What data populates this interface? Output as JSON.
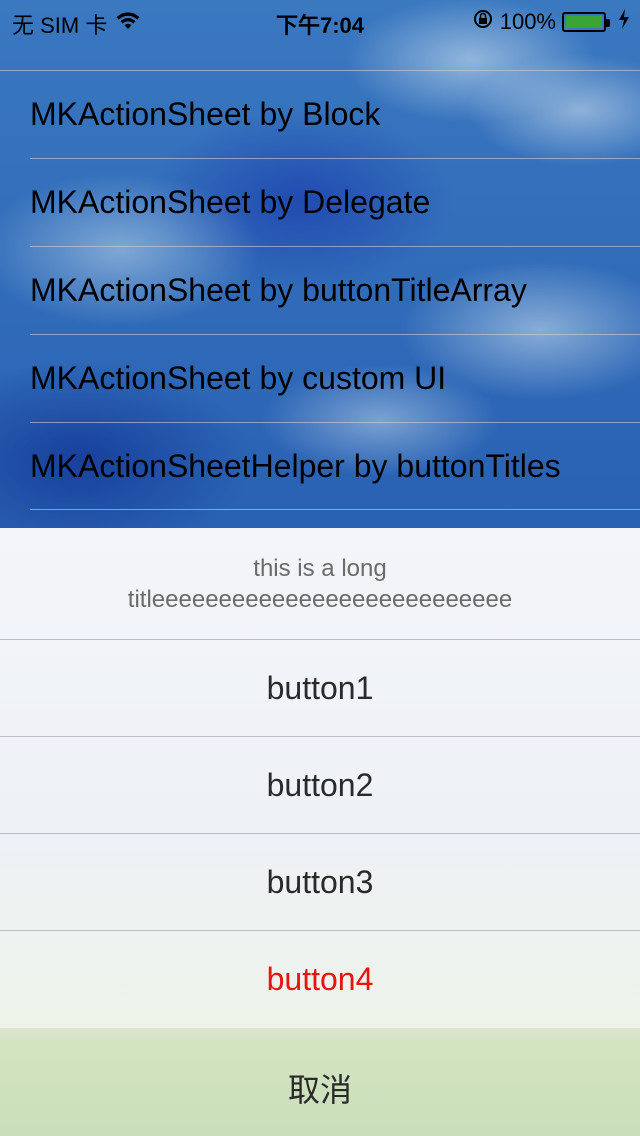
{
  "status_bar": {
    "carrier": "无 SIM 卡",
    "time": "下午7:04",
    "battery": "100%",
    "battery_level": 1.0,
    "icons": [
      "wifi-icon",
      "rotation-lock-icon",
      "battery-icon",
      "charging-icon"
    ]
  },
  "list": {
    "items": [
      {
        "label": "MKActionSheet by Block"
      },
      {
        "label": "MKActionSheet by Delegate"
      },
      {
        "label": "MKActionSheet by buttonTitleArray"
      },
      {
        "label": "MKActionSheet by custom UI"
      },
      {
        "label": "MKActionSheetHelper by buttonTitles"
      }
    ]
  },
  "action_sheet": {
    "title_line1": "this is a long",
    "title_line2": "titleeeeeeeeeeeeeeeeeeeeeeeeeee",
    "buttons": [
      {
        "label": "button1"
      },
      {
        "label": "button2"
      },
      {
        "label": "button3"
      },
      {
        "label": "button4",
        "color": "#e8150f"
      }
    ],
    "cancel_label": "取消"
  }
}
